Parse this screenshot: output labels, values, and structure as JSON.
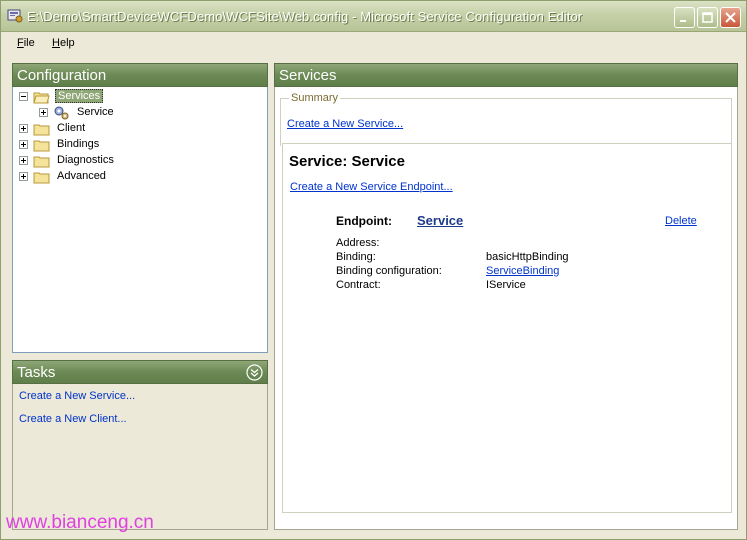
{
  "window": {
    "title": "E:\\Demo\\SmartDeviceWCFDemo\\WCFSite\\Web.config - Microsoft Service Configuration Editor"
  },
  "menu": {
    "file": "File",
    "help": "Help"
  },
  "configuration": {
    "header": "Configuration",
    "tree": [
      {
        "label": "Services",
        "expanded": true,
        "selected": true
      },
      {
        "label": "Service",
        "expanded": false,
        "selected": false
      },
      {
        "label": "Client",
        "expanded": false,
        "selected": false
      },
      {
        "label": "Bindings",
        "expanded": false,
        "selected": false
      },
      {
        "label": "Diagnostics",
        "expanded": false,
        "selected": false
      },
      {
        "label": "Advanced",
        "expanded": false,
        "selected": false
      }
    ]
  },
  "tasks": {
    "header": "Tasks",
    "items": [
      {
        "label": "Create a New Service..."
      },
      {
        "label": "Create a New Client..."
      }
    ]
  },
  "services": {
    "header": "Services",
    "summary_legend": "Summary",
    "create_service_link": "Create a New Service...",
    "service_title": "Service: Service",
    "create_endpoint_link": "Create a New Service Endpoint...",
    "endpoint": {
      "label": "Endpoint:",
      "name": "Service",
      "delete_link": "Delete",
      "properties": [
        {
          "key": "Address:",
          "value": ""
        },
        {
          "key": "Binding:",
          "value": "basicHttpBinding"
        },
        {
          "key": "Binding configuration:",
          "value": "ServiceBinding",
          "is_link": true
        },
        {
          "key": "Contract:",
          "value": "IService"
        }
      ]
    }
  },
  "watermark": "www.bianceng.cn",
  "colors": {
    "panel_header": "#6c8a55",
    "link": "#0033cc",
    "watermark": "#e040e0"
  }
}
